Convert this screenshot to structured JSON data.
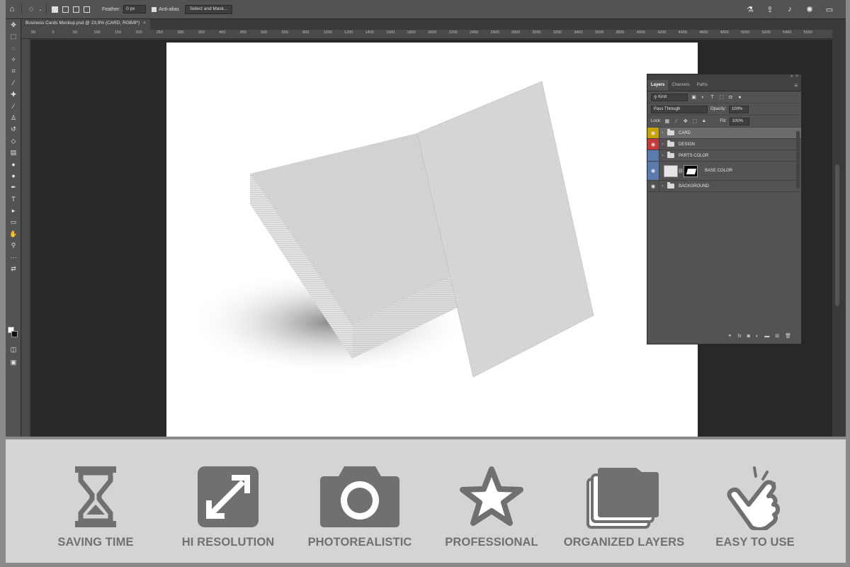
{
  "options_bar": {
    "feather_label": "Feather:",
    "feather_value": "0 px",
    "antialias_label": "Anti-alias",
    "select_mask_label": "Select and Mask..."
  },
  "document_tab": {
    "title": "Business Cards Mockup.psd @ 23,9% (CARD, RGB/8*)",
    "close": "×"
  },
  "ruler_ticks": [
    "50",
    "0",
    "50",
    "100",
    "150",
    "200",
    "250",
    "300",
    "350",
    "400",
    "450",
    "500",
    "600",
    "800",
    "1000",
    "1200",
    "1400",
    "1600",
    "1800",
    "2000",
    "2200",
    "2400",
    "2600",
    "2800",
    "3000",
    "3200",
    "3400",
    "3600",
    "3800",
    "4000",
    "4200",
    "4400",
    "4600",
    "4800",
    "5000",
    "5200",
    "5400",
    "5600"
  ],
  "layers_panel": {
    "tabs": [
      "Layers",
      "Channels",
      "Paths"
    ],
    "filter_kind": "Kind",
    "blend_mode": "Pass Through",
    "opacity_label": "Opacity:",
    "opacity_value": "100%",
    "lock_label": "Lock:",
    "fill_label": "Fill:",
    "fill_value": "100%",
    "layers": [
      {
        "name": "CARD",
        "type": "group",
        "color": "#c8a200",
        "visible": true
      },
      {
        "name": "DESIGN",
        "type": "group",
        "color": "#c43a3a",
        "visible": true
      },
      {
        "name": "PARTS COLOR",
        "type": "group",
        "color": "#5a7bb0",
        "visible": false
      },
      {
        "name": "BASE COLOR",
        "type": "layer",
        "color": "#5a7bb0",
        "visible": true
      },
      {
        "name": "BACKGROUND",
        "type": "group",
        "color": "",
        "visible": true
      }
    ],
    "footer_fx": "fx"
  },
  "features": [
    {
      "label": "SAVING TIME",
      "icon": "hourglass-icon"
    },
    {
      "label": "HI RESOLUTION",
      "icon": "expand-icon"
    },
    {
      "label": "PHOTOREALISTIC",
      "icon": "camera-icon"
    },
    {
      "label": "PROFESSIONAL",
      "icon": "star-icon"
    },
    {
      "label": "ORGANIZED LAYERS",
      "icon": "folders-icon"
    },
    {
      "label": "EASY TO USE",
      "icon": "hand-tap-icon"
    }
  ],
  "colors": {
    "app_bg": "#535353",
    "workspace_bg": "#282828",
    "feature_strip_bg": "#d4d4d4",
    "feature_icon": "#707070"
  }
}
